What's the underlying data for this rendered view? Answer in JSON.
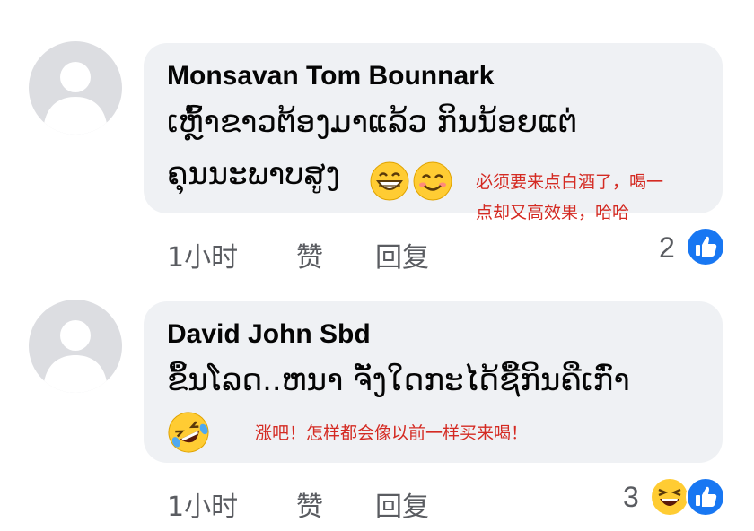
{
  "comments": [
    {
      "author": "Monsavan Tom Bounnark",
      "text_line1": "ເຫຼົ້າຂາວຕ້ອງມາແລ້ວ ກິນນ້ອຍແຕ່",
      "text_line2": "ຄຸນນະພາບສູງ",
      "emojis": [
        "grinning-face-icon",
        "smiling-face-icon"
      ],
      "translation_line1": "必须要来点白酒了，喝一",
      "translation_line2": "点却又高效果，哈哈",
      "time": "1小时",
      "like_label": "赞",
      "reply_label": "回复",
      "reaction_count": "2",
      "reactions": [
        "like-icon"
      ]
    },
    {
      "author": "David John Sbd",
      "text_line1": "ຂຶ້ນໂລດ..ຫນາ ຈັ່ງໃດກະໄດ້ຊື້ກິນຄືເກົ່າ",
      "emojis": [
        "rolling-laughing-face-icon"
      ],
      "translation_line1": "涨吧！怎样都会像以前一样买来喝！",
      "time": "1小时",
      "like_label": "赞",
      "reply_label": "回复",
      "reaction_count": "3",
      "reactions": [
        "haha-icon",
        "like-icon"
      ]
    }
  ],
  "colors": {
    "bubble": "#eff1f4",
    "avatar": "#dcdde1",
    "translation": "#d42a22",
    "like_blue": "#1877f2",
    "meta": "#5a5c61"
  }
}
